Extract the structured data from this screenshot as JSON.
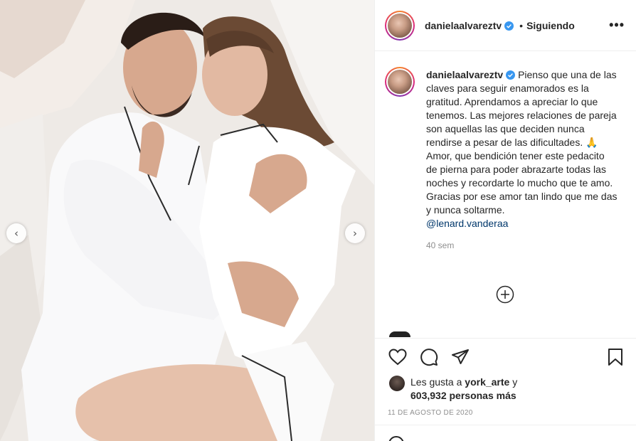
{
  "post": {
    "username": "danielaalvareztv",
    "separator": "•",
    "follow_status": "Siguiendo",
    "more_label": "•••",
    "caption": "Pienso que una de las claves para seguir enamorados es la gratitud. Aprendamos a apreciar lo que tenemos. Las mejores relaciones de pareja son aquellas las que deciden nunca rendirse a pesar de las dificultades. 🙏 Amor, que bendición tener este pedacito de pierna para poder abrazarte todas las noches y recordarte lo mucho que te amo. Gracias por ese amor tan lindo que me das y nunca soltarme.",
    "mention": "@lenard.vanderaa",
    "time_ago": "40 sem",
    "likes": {
      "prefix": "Les gusta a",
      "user": "york_arte",
      "joiner": "y",
      "count": "603,932",
      "suffix": "personas más"
    },
    "date": "11 DE AGOSTO DE 2020"
  },
  "carousel": {
    "prev_label": "‹",
    "next_label": "›"
  },
  "icons": {
    "like": "heart-icon",
    "comment": "comment-icon",
    "share": "share-icon",
    "save": "bookmark-icon",
    "verified": "verified-badge-icon",
    "load_more": "plus-circle-icon",
    "emoji": "emoji-icon"
  },
  "colors": {
    "text": "#262626",
    "muted": "#8e8e8e",
    "link": "#00376b",
    "verified": "#3897f0",
    "border": "#efefef"
  }
}
